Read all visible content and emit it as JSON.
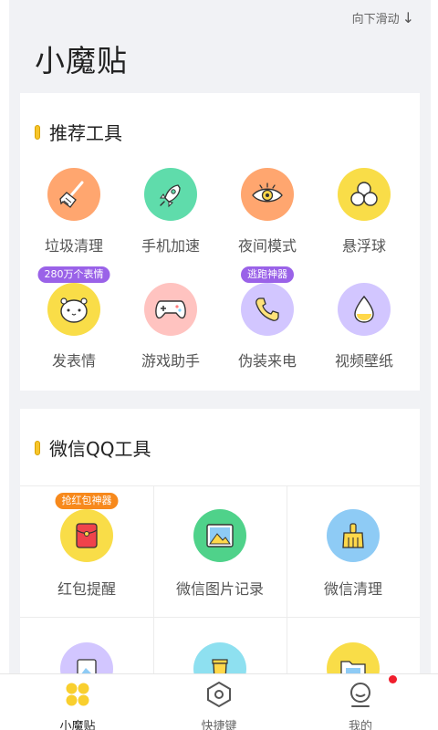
{
  "header": {
    "scroll_hint": "向下滑动",
    "title": "小魔贴"
  },
  "recommended": {
    "title": "推荐工具",
    "items": [
      {
        "label": "垃圾清理",
        "icon": "broom-icon",
        "color": "#ffa66f"
      },
      {
        "label": "手机加速",
        "icon": "rocket-icon",
        "color": "#5fdcab"
      },
      {
        "label": "夜间模式",
        "icon": "eye-icon",
        "color": "#ffa66f"
      },
      {
        "label": "悬浮球",
        "icon": "floating-ball-icon",
        "color": "#f9dd48"
      },
      {
        "label": "发表情",
        "icon": "hamster-face-icon",
        "color": "#f9dd48",
        "badge": "280万个表情"
      },
      {
        "label": "游戏助手",
        "icon": "gamepad-icon",
        "color": "#ffc3c0"
      },
      {
        "label": "伪装来电",
        "icon": "phone-icon",
        "color": "#d2c6ff",
        "badge": "逃跑神器"
      },
      {
        "label": "视频壁纸",
        "icon": "droplet-icon",
        "color": "#d2c6ff"
      }
    ]
  },
  "wechat_qq": {
    "title": "微信QQ工具",
    "items": [
      {
        "label": "红包提醒",
        "icon": "red-envelope-icon",
        "color": "#f9dd48",
        "badge": "抢红包神器"
      },
      {
        "label": "微信图片记录",
        "icon": "picture-icon",
        "color": "#4fd28a"
      },
      {
        "label": "微信清理",
        "icon": "broom-icon",
        "color": "#8ecbf5"
      },
      {
        "label": "",
        "icon": "image-tool-icon",
        "color": "#d2c6ff"
      },
      {
        "label": "",
        "icon": "trash-can-icon",
        "color": "#8ee0f0"
      },
      {
        "label": "",
        "icon": "folder-icon",
        "color": "#f9dd48"
      }
    ]
  },
  "tabbar": {
    "items": [
      {
        "label": "小魔贴",
        "icon": "four-dots-icon",
        "active": true
      },
      {
        "label": "快捷键",
        "icon": "hexagon-icon",
        "active": false
      },
      {
        "label": "我的",
        "icon": "smile-user-icon",
        "active": false
      }
    ],
    "notification_dot_color": "#f01e2c"
  }
}
